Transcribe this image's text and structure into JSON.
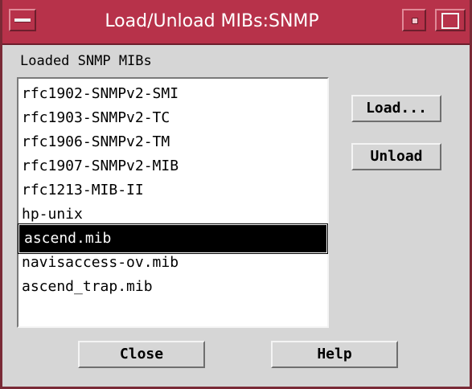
{
  "window": {
    "title": "Load/Unload MIBs:SNMP",
    "accent_color": "#b7324a",
    "icons": [
      "window-menu-icon",
      "minimize-icon",
      "maximize-icon"
    ]
  },
  "list": {
    "label": "Loaded SNMP MIBs",
    "items": [
      "rfc1902-SNMPv2-SMI",
      "rfc1903-SNMPv2-TC",
      "rfc1906-SNMPv2-TM",
      "rfc1907-SNMPv2-MIB",
      "rfc1213-MIB-II",
      "hp-unix",
      "ascend.mib",
      "navisaccess-ov.mib",
      "ascend_trap.mib"
    ],
    "selected_index": 6
  },
  "buttons": {
    "load": "Load...",
    "unload": "Unload",
    "close": "Close",
    "help": "Help"
  }
}
